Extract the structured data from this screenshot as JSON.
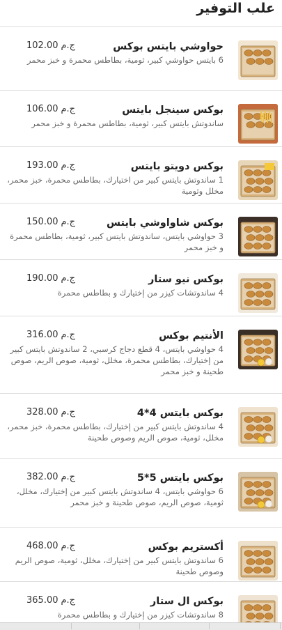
{
  "section": {
    "title": "علب التوفير"
  },
  "currency": "ج.م",
  "colors": {
    "box_tan": "#d8b27a",
    "box_dark": "#3a2f27",
    "bread": "#c98a3c",
    "fries": "#f1c24a",
    "sauce_white": "#f4efe6",
    "brand_yellow": "#f5c83a"
  },
  "items": [
    {
      "name": "حواوشي بايتس بوكس",
      "desc": "6 بايتس حواوشي كبير، ثومية، بطاطس محمرة و خبز محمر",
      "price": "102.00",
      "image_icon": "food-box-icon"
    },
    {
      "name": "بوكس سينجل بايتس",
      "desc": "ساندوتش بايتس كبير، ثومية، بطاطس محمرة و خبز محمر",
      "price": "106.00",
      "image_icon": "food-box-icon"
    },
    {
      "name": "بوكس دويتو بايتس",
      "desc": "1 ساندوتش بايتس كبير من اختيارك، بطاطس محمرة، خبز محمر، مخلل وثومية",
      "price": "193.00",
      "image_icon": "food-box-icon"
    },
    {
      "name": "بوكس شاواوشي بايتس",
      "desc": "3 حواوشي بايتس، ساندوتش بايتس كبير، ثومية، بطاطس محمرة و خبز محمر",
      "price": "150.00",
      "image_icon": "food-box-icon"
    },
    {
      "name": "بوكس نيو ستار",
      "desc": "4 ساندوتشات كيزر من إختيارك و بطاطس محمرة",
      "price": "190.00",
      "image_icon": "food-box-icon"
    },
    {
      "name": "الأنتيم بوكس",
      "desc": "4 حواوشي بايتس، 4 قطع دجاج كرسبي، 2 ساندوتش بايتس كبير من إختيارك، بطاطس محمرة، مخلل، ثومية، صوص الريم، صوص طحينة و خبز محمر",
      "price": "316.00",
      "image_icon": "food-box-icon"
    },
    {
      "name": "بوكس بايتس 4*4",
      "desc": "4 ساندوتش بايتس كبير من إختيارك، بطاطس محمرة، خبز محمر، مخلل، ثومية، صوص الريم وصوص طحينة",
      "price": "328.00",
      "image_icon": "food-box-icon"
    },
    {
      "name": "بوكس بايتس 5*5",
      "desc": "6 حواوشي بايتس، 4 ساندوتش بايتس كبير من إختيارك، مخلل، ثومية، صوص الريم، صوص طحينة و خبز محمر",
      "price": "382.00",
      "image_icon": "food-box-icon"
    },
    {
      "name": "أكستريم بوكس",
      "desc": "6 ساندوتش بايتس كبير من إختيارك، مخلل، ثومية، صوص الريم وصوص طحينة",
      "price": "468.00",
      "image_icon": "food-box-icon"
    },
    {
      "name": "بوكس ال ستار",
      "desc": "8 ساندوتشات كيزر من إختيارك و بطاطس محمرة",
      "price": "365.00",
      "image_icon": "food-box-icon"
    }
  ]
}
